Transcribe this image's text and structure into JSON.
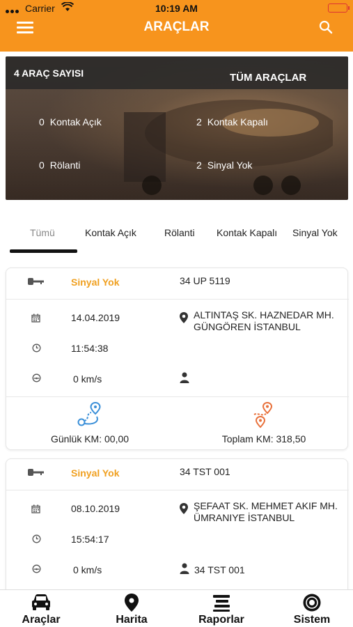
{
  "status_bar": {
    "carrier": "Carrier",
    "time": "10:19 AM"
  },
  "header": {
    "title": "ARAÇLAR"
  },
  "banner": {
    "count_label": "4 ARAÇ SAYISI",
    "all_label": "TÜM ARAÇLAR",
    "stats": [
      {
        "num": "0",
        "label": "Kontak Açık"
      },
      {
        "num": "2",
        "label": "Kontak Kapalı"
      },
      {
        "num": "0",
        "label": "Rölanti"
      },
      {
        "num": "2",
        "label": "Sinyal Yok"
      }
    ]
  },
  "tabs": [
    {
      "label": "Tümü"
    },
    {
      "label": "Kontak Açık"
    },
    {
      "label": "Rölanti"
    },
    {
      "label": "Kontak Kapalı"
    },
    {
      "label": "Sinyal Yok"
    }
  ],
  "vehicles": [
    {
      "status": "Sinyal Yok",
      "plate": "34 UP 5119",
      "date": "14.04.2019",
      "address_line1": "ALTINTAŞ SK. HAZNEDAR MH.",
      "address_line2": "GÜNGÖREN İSTANBUL",
      "time": "11:54:38",
      "speed": "0 km/s",
      "driver": "",
      "daily_km": "Günlük KM: 00,00",
      "total_km": "Toplam KM: 318,50"
    },
    {
      "status": "Sinyal Yok",
      "plate": "34 TST 001",
      "date": "08.10.2019",
      "address_line1": "ŞEFAAT SK. MEHMET AKIF MH.",
      "address_line2": "ÜMRANIYE İSTANBUL",
      "time": "15:54:17",
      "speed": "0 km/s",
      "driver": "34 TST 001"
    }
  ],
  "bottom_nav": [
    {
      "label": "Araçlar"
    },
    {
      "label": "Harita"
    },
    {
      "label": "Raporlar"
    },
    {
      "label": "Sistem"
    }
  ],
  "colors": {
    "accent": "#f7941d",
    "status_warning": "#f0a020"
  }
}
